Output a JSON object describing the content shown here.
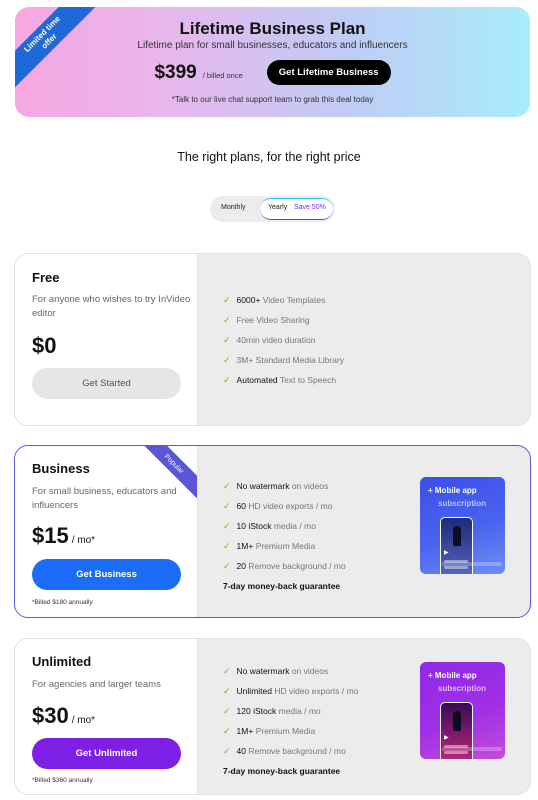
{
  "lifetime": {
    "ribbon": "Limited time offer",
    "title": "Lifetime Business Plan",
    "subtitle": "Lifetime plan for small businesses, educators and influencers",
    "price": "$399",
    "billed": "/ billed once",
    "button": "Get Lifetime Business",
    "note": "*Talk to our live chat support team to grab this deal today",
    "colors": {
      "gradient_start": "#f7a7e1",
      "gradient_end": "#a8ecfb",
      "ribbon": "#1f6ad8"
    }
  },
  "tagline": "The right plans, for the right price",
  "toggle": {
    "monthly": "Monthly",
    "yearly": "Yearly",
    "save": "Save 50%",
    "selected": "Yearly"
  },
  "plans": [
    {
      "name": "Free",
      "desc": "For anyone who wishes to try InVideo editor",
      "price": "$0",
      "per": "",
      "button": "Get Started",
      "billed": "",
      "features": [
        {
          "strong": "6000+",
          "text": " Video Templates"
        },
        {
          "strong": "",
          "text": "Free Video Sharing"
        },
        {
          "strong": "",
          "text": "40min video duration"
        },
        {
          "strong": "",
          "text": "3M+ Standard Media Library"
        },
        {
          "strong": "Automated",
          "text": " Text to Speech"
        }
      ]
    },
    {
      "name": "Business",
      "badge": "Popular",
      "desc": "For small business, educators and influencers",
      "price": "$15",
      "per": "/ mo*",
      "button": "Get Business",
      "billed": "*Billed $180 annually",
      "features": [
        {
          "strong": "No watermark",
          "text": " on videos"
        },
        {
          "strong": "60",
          "text": " HD video exports / mo"
        },
        {
          "strong": "10 iStock",
          "text": " media / mo"
        },
        {
          "strong": "1M+",
          "text": " Premium Media"
        },
        {
          "strong": "20",
          "text": " Remove background / mo"
        }
      ],
      "guarantee": "7-day money-back guarantee",
      "promo": {
        "title": "+ Mobile app",
        "subtitle": "subscription"
      },
      "accent": "#1b6cf7"
    },
    {
      "name": "Unlimited",
      "desc": "For agencies and larger teams",
      "price": "$30",
      "per": "/ mo*",
      "button": "Get Unlimited",
      "billed": "*Billed $360 annually",
      "features": [
        {
          "strong": "No watermark",
          "text": " on videos"
        },
        {
          "strong": "Unlimited",
          "text": " HD video exports / mo"
        },
        {
          "strong": "120 iStock",
          "text": " media / mo"
        },
        {
          "strong": "1M+",
          "text": " Premium Media"
        },
        {
          "strong": "40",
          "text": " Remove background / mo"
        }
      ],
      "guarantee": "7-day money-back guarantee",
      "promo": {
        "title": "+ Mobile app",
        "subtitle": "subscription"
      },
      "accent": "#7e1fe6"
    }
  ]
}
